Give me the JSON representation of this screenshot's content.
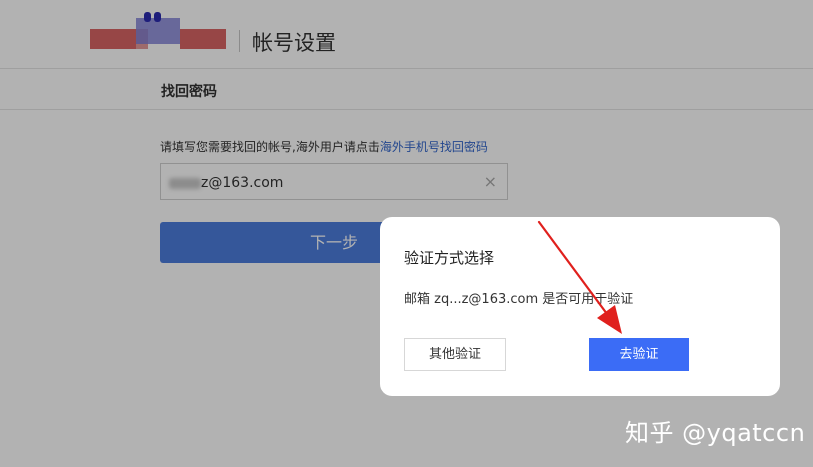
{
  "header": {
    "title": "帐号设置"
  },
  "section": {
    "title": "找回密码"
  },
  "instruction": {
    "text": "请填写您需要找回的帐号,海外用户请点击",
    "link": "海外手机号找回密码"
  },
  "email_input": {
    "value": "z@163.com",
    "clear_icon": "×"
  },
  "next_button": {
    "label": "下一步"
  },
  "dialog": {
    "title": "验证方式选择",
    "message": "邮箱 zq...z@163.com 是否可用于验证",
    "other_button": "其他验证",
    "verify_button": "去验证"
  },
  "watermark": {
    "text": "知乎 @yqatccn"
  },
  "colors": {
    "primary": "#3b6cf6",
    "link": "#3366cc",
    "arrow": "#e0201d"
  },
  "icons": {
    "clear": "close-icon",
    "annotation": "red-arrow-icon"
  }
}
